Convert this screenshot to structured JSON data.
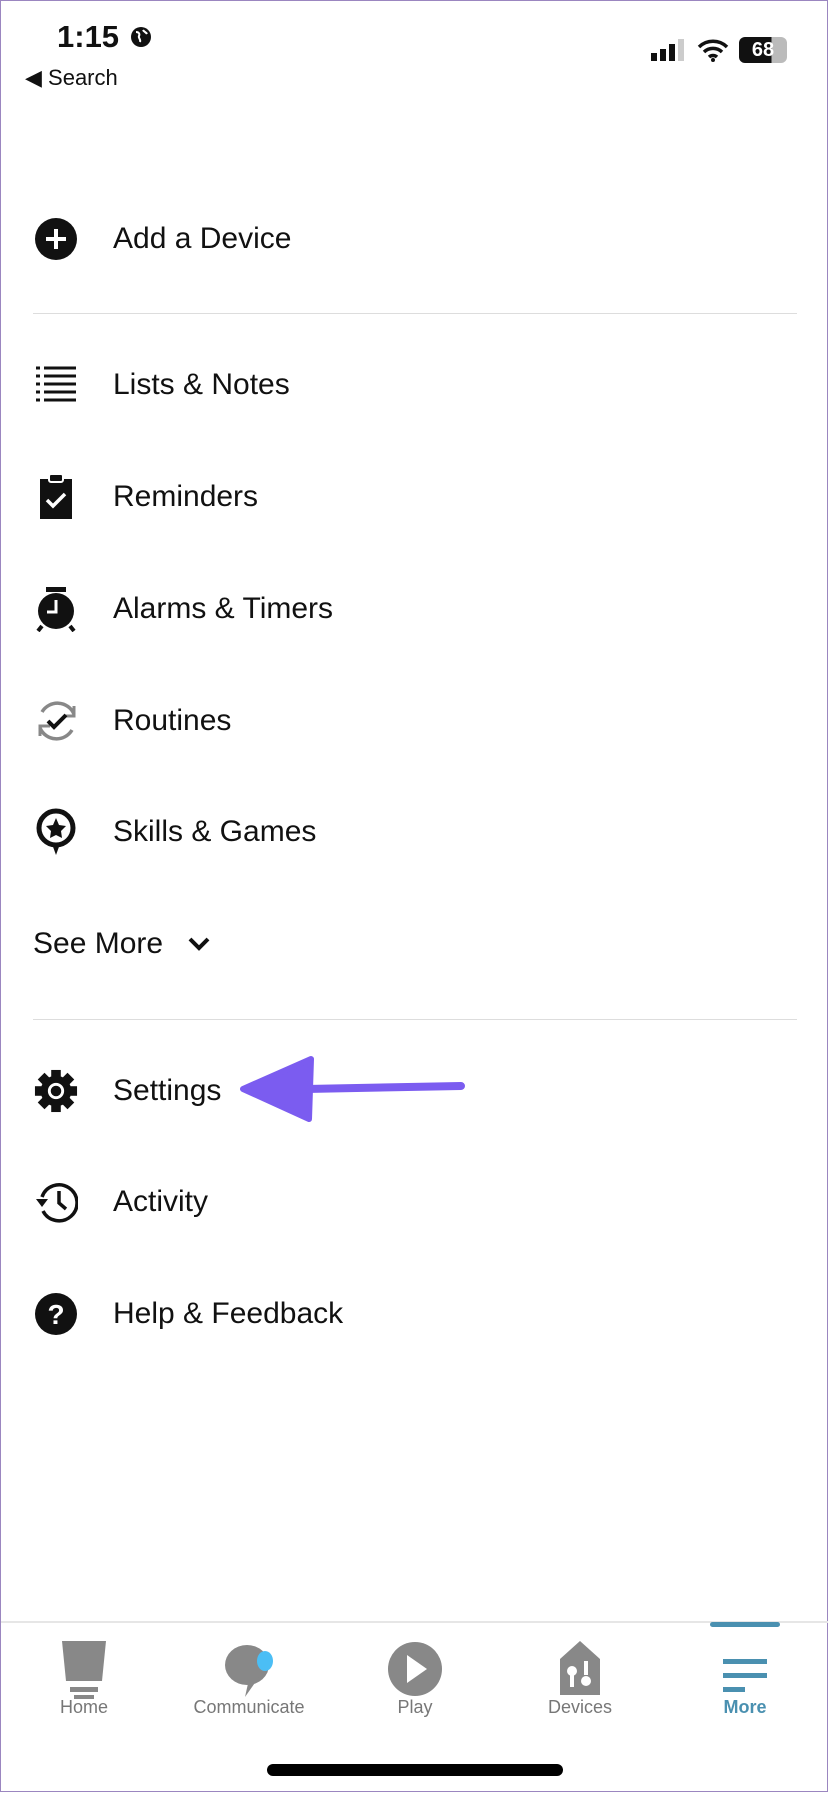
{
  "status_bar": {
    "time": "1:15",
    "back_label": "Search",
    "battery": "68"
  },
  "menu": {
    "add_device": "Add a Device",
    "items": [
      {
        "label": "Lists & Notes",
        "icon": "list-icon"
      },
      {
        "label": "Reminders",
        "icon": "clipboard-check-icon"
      },
      {
        "label": "Alarms & Timers",
        "icon": "alarm-clock-icon"
      },
      {
        "label": "Routines",
        "icon": "routine-check-icon"
      },
      {
        "label": "Skills & Games",
        "icon": "star-bubble-icon"
      }
    ],
    "see_more": "See More",
    "bottom_items": [
      {
        "label": "Settings",
        "icon": "gear-icon"
      },
      {
        "label": "Activity",
        "icon": "history-icon"
      },
      {
        "label": "Help & Feedback",
        "icon": "help-icon"
      }
    ]
  },
  "annotation": {
    "color": "#7b5cf0"
  },
  "tabs": [
    {
      "label": "Home"
    },
    {
      "label": "Communicate"
    },
    {
      "label": "Play"
    },
    {
      "label": "Devices"
    },
    {
      "label": "More",
      "active": true
    }
  ],
  "colors": {
    "accent": "#4a90b0",
    "tab_icon": "#888888",
    "notify_dot": "#4bbef5"
  }
}
